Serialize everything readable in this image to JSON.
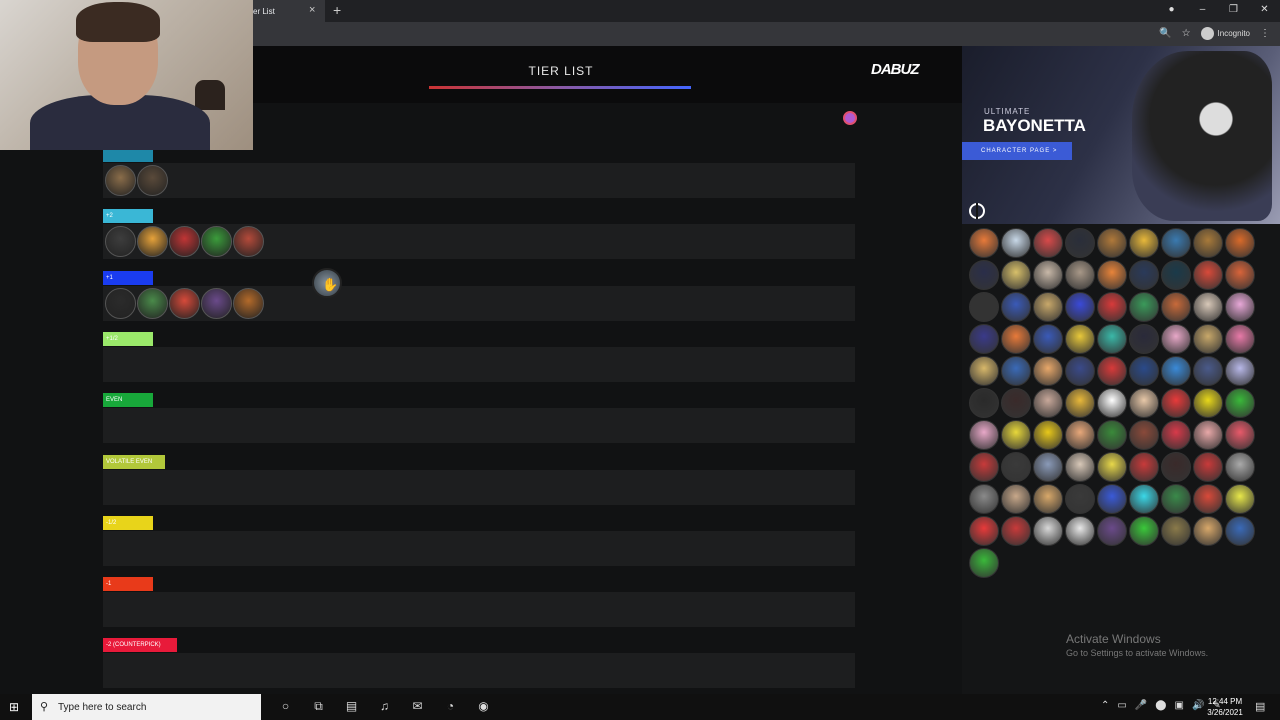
{
  "browser": {
    "tab_title": "er List",
    "tab_close": "×",
    "new_tab": "+",
    "window_buttons": [
      "●",
      "–",
      "❐",
      "✕"
    ],
    "incognito_label": "Incognito",
    "toolbar_icons": [
      "🔍",
      "☆",
      "⋮"
    ]
  },
  "header": {
    "title": "TIER LIST",
    "logo": "DABUZ"
  },
  "tiers": [
    {
      "label": "",
      "color": "#1e88a8",
      "portraits": [
        "#8a6d4a",
        "#5a4a3a"
      ]
    },
    {
      "label": "+2",
      "color": "#3ab7d6",
      "portraits": [
        "#3d3d3d",
        "#e6a23a",
        "#c03535",
        "#3b9c3b",
        "#b44a3a"
      ]
    },
    {
      "label": "+1",
      "color": "#1a3cf0",
      "portraits": [
        "#2b2b2b",
        "#4a8a4a",
        "#d64a3a",
        "#6a4a8a",
        "#b36a2a"
      ]
    },
    {
      "label": "+1/2",
      "color": "#9ae86a",
      "portraits": []
    },
    {
      "label": "EVEN",
      "color": "#18a83a",
      "portraits": []
    },
    {
      "label": "VOLATILE EVEN",
      "color": "#b2c83a",
      "portraits": []
    },
    {
      "label": "-1/2",
      "color": "#e8d41a",
      "portraits": []
    },
    {
      "label": "-1",
      "color": "#e83a1a",
      "portraits": []
    },
    {
      "label": "-2 (COUNTERPICK)",
      "color": "#e81a3a",
      "portraits": []
    }
  ],
  "banner": {
    "series": "ULTIMATE",
    "character": "BAYONETTA",
    "button": "CHARACTER PAGE >"
  },
  "roster_colors": [
    "#e87a3a",
    "#c8d8e8",
    "#d84a4a",
    "#2a2e3a",
    "#b0793a",
    "#e8b83a",
    "#3a7ab0",
    "#a87a3a",
    "#d86a2a",
    "#2a2e4a",
    "#d8c06a",
    "#c8b8a8",
    "#a89888",
    "#e8843a",
    "#2a3a5a",
    "#1a3a4a",
    "#d84a3a",
    "#d8643a",
    "#333",
    "#3a5ab8",
    "#c8a86a",
    "#3a4ad8",
    "#d83a3a",
    "#3a9a5a",
    "#c86a3a",
    "#d8c8b8",
    "#e8a8d8",
    "#3a3a8a",
    "#e87a3a",
    "#3a5ab8",
    "#e8c83a",
    "#3ab8a8",
    "#2a2a3a",
    "#e8a8c8",
    "#c8a86a",
    "#e87aa8",
    "#d8b86a",
    "#3a6ab8",
    "#e8a86a",
    "#3a4a8a",
    "#d83a3a",
    "#2a4a8a",
    "#3a8ad8",
    "#4a5a8a",
    "#b8b8e8",
    "#2a2a2a",
    "#3a2a2a",
    "#c8a89a",
    "#e8b83a",
    "#fff",
    "#e8c8a8",
    "#e83a3a",
    "#e8d81a",
    "#3ab83a",
    "#e8a8c8",
    "#e8d83a",
    "#e8c81a",
    "#e8a87a",
    "#3a8a3a",
    "#8a4a3a",
    "#d83a4a",
    "#e8a8a8",
    "#e85a6a",
    "#c83a3a",
    "#3a3a3a",
    "#8a9ab8",
    "#d8c8b8",
    "#e8d84a",
    "#c83a3a",
    "#3a2a2a",
    "#c83a3a",
    "#aaa",
    "#8a8a8a",
    "#c8a88a",
    "#d8a86a",
    "#3a3a3a",
    "#3a5ad8",
    "#3ad8e8",
    "#3a8a4a",
    "#d84a3a",
    "#e8e84a",
    "#e83a3a",
    "#c83a3a",
    "#d8d8d8",
    "#e8e8e8",
    "#6a4a8a",
    "#3ac83a",
    "#8a7a4a",
    "#d8a86a",
    "#3a6ab8",
    "#3ab83a"
  ],
  "watermark": {
    "line1": "Activate Windows",
    "line2": "Go to Settings to activate Windows."
  },
  "taskbar": {
    "start_icon": "⊞",
    "search_placeholder": "Type here to search",
    "search_icon": "⚲",
    "app_icons": [
      "○",
      "⧉",
      "▤",
      "♫",
      "✉",
      "◔",
      "◉"
    ],
    "tray_icons": [
      "⌃",
      "▭",
      "🎤",
      "⬤",
      "▣",
      "🔊",
      "✎"
    ],
    "time": "12:44 PM",
    "date": "3/26/2021",
    "notification_icon": "▤"
  }
}
